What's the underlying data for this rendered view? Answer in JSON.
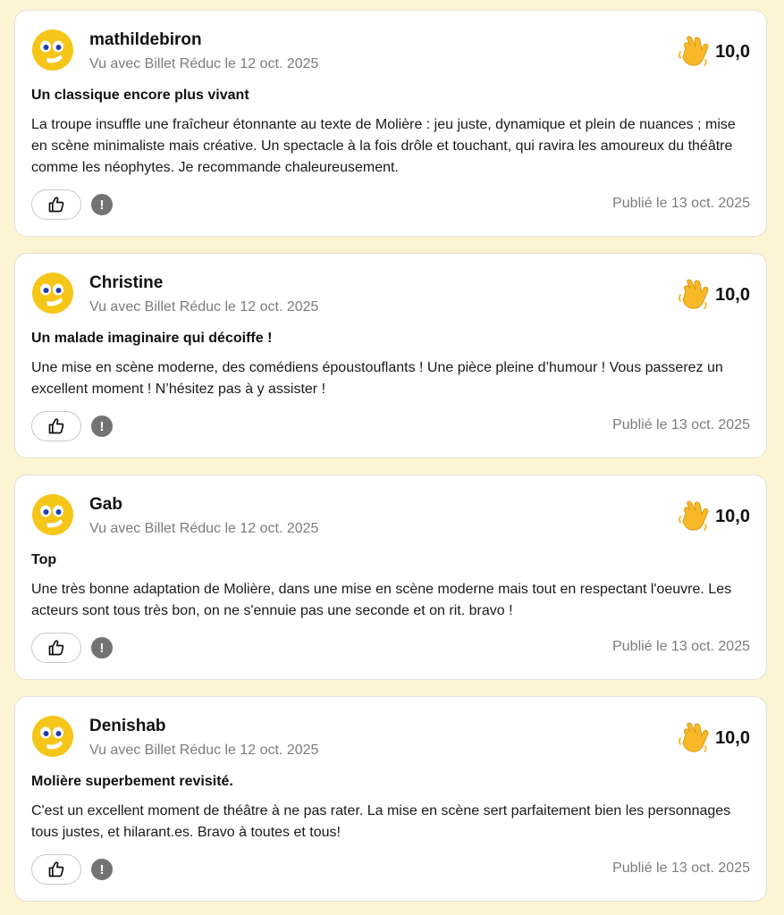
{
  "colors": {
    "page_background": "#fdf4d3",
    "card_background": "#ffffff",
    "muted_text": "#7c7c7c",
    "avatar_yellow": "#f5c518",
    "wave_emoji": "#f7b928"
  },
  "icons": {
    "avatar": "smiley-face-icon",
    "rating": "waving-hand-icon",
    "like": "thumbs-up-icon",
    "report": "exclamation-icon"
  },
  "reviews": [
    {
      "username": "mathildebiron",
      "seen_with": "Vu avec Billet Réduc le 12 oct. 2025",
      "rating": "10,0",
      "title": "Un classique encore plus vivant",
      "body": "La troupe insuffle une fraîcheur étonnante au texte de Molière : jeu juste, dynamique et plein de nuances ; mise en scène minimaliste mais créative. Un spectacle à la fois drôle et touchant, qui ravira les amoureux du théâtre comme les néophytes. Je recommande chaleureusement.",
      "published": "Publié le 13 oct. 2025",
      "report_glyph": "!"
    },
    {
      "username": "Christine",
      "seen_with": "Vu avec Billet Réduc le 12 oct. 2025",
      "rating": "10,0",
      "title": "Un malade imaginaire qui décoiffe !",
      "body": "Une mise en scène moderne, des comédiens époustouflants ! Une pièce pleine d’humour ! Vous passerez un excellent moment ! N’hésitez pas à y assister !",
      "published": "Publié le 13 oct. 2025",
      "report_glyph": "!"
    },
    {
      "username": "Gab",
      "seen_with": "Vu avec Billet Réduc le 12 oct. 2025",
      "rating": "10,0",
      "title": "Top",
      "body": "Une très bonne adaptation de Molière, dans une mise en scène moderne mais tout en respectant l'oeuvre. Les acteurs sont tous très bon, on ne s'ennuie pas une seconde et on rit. bravo !",
      "published": "Publié le 13 oct. 2025",
      "report_glyph": "!"
    },
    {
      "username": "Denishab",
      "seen_with": "Vu avec Billet Réduc le 12 oct. 2025",
      "rating": "10,0",
      "title": "Molière superbement revisité.",
      "body": "C'est un excellent moment de théâtre à ne pas rater. La mise en scène sert parfaitement bien les personnages tous justes, et hilarant.es. Bravo à toutes et tous!",
      "published": "Publié le 13 oct. 2025",
      "report_glyph": "!"
    }
  ]
}
